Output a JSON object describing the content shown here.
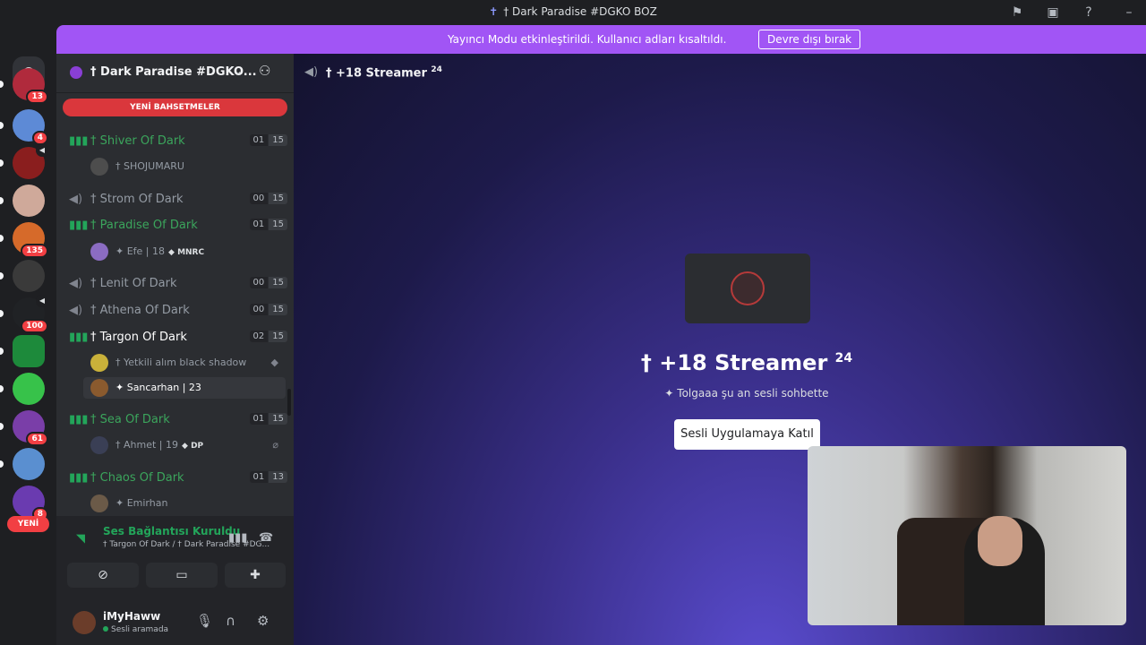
{
  "window": {
    "title": "† Dark Paradise #DGKO BOZ"
  },
  "notice": {
    "text": "Yayıncı Modu etkinleştirildi. Kullanıcı adları kısaltıldı.",
    "button": "Devre dışı bırak"
  },
  "guilds": {
    "badges": [
      "13",
      "4",
      "135",
      "100",
      "61",
      "8"
    ],
    "new_label": "YENİ"
  },
  "server": {
    "name": "† Dark Paradise #DGKO..."
  },
  "mentions_label": "YENİ BAHSETMELER",
  "channels": [
    {
      "name": "† Shiver Of Dark",
      "users": "01",
      "limit": "15",
      "members": [
        {
          "name": "† SHOJUMARU"
        }
      ]
    },
    {
      "name": "† Strom Of Dark",
      "users": "00",
      "limit": "15",
      "members": []
    },
    {
      "name": "† Paradise Of Dark",
      "users": "01",
      "limit": "15",
      "members": [
        {
          "name": "✦ Efe | 18",
          "tag": "MNRC"
        }
      ]
    },
    {
      "name": "† Lenit Of Dark",
      "users": "00",
      "limit": "15",
      "members": []
    },
    {
      "name": "† Athena Of Dark",
      "users": "00",
      "limit": "15",
      "members": []
    },
    {
      "name": "† Targon Of Dark",
      "users": "02",
      "limit": "15",
      "members": [
        {
          "name": "† Yetkili alım black shadow"
        },
        {
          "name": "✦ Sancarhan | 23"
        }
      ]
    },
    {
      "name": "† Sea Of Dark",
      "users": "01",
      "limit": "15",
      "members": [
        {
          "name": "† Ahmet | 19",
          "tag": "DP"
        }
      ]
    },
    {
      "name": "† Chaos Of Dark",
      "users": "01",
      "limit": "13",
      "members": [
        {
          "name": "✦ Emirhan"
        }
      ]
    }
  ],
  "voice_panel": {
    "status": "Ses Bağlantısı Kuruldu",
    "location": "† Targon Of Dark / † Dark Paradise #DG..."
  },
  "user": {
    "name": "iMyHaww",
    "status": "Sesli aramada"
  },
  "main": {
    "channel_name": "† +18 Streamer",
    "channel_sup": "24",
    "big_title": "† +18 Streamer",
    "big_sup": "24",
    "subtitle": "✦ Tolgaaa şu an sesli sohbette",
    "join_button": "Sesli Uygulamaya Katıl"
  },
  "colors": {
    "notice_bg": "#a155f5",
    "mentions_bg": "#da373c",
    "active_green": "#23a55a"
  }
}
